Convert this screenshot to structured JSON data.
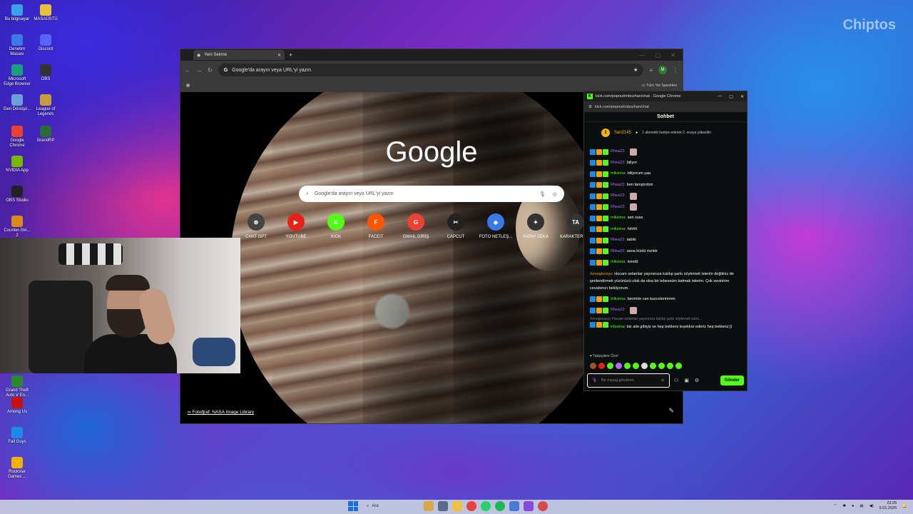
{
  "watermark": "Chiptos",
  "desktop_icons": [
    {
      "label": "Bu bilgisayar",
      "color": "#3aa0e8"
    },
    {
      "label": "MASAÜSTÜ",
      "color": "#e8c23a"
    },
    {
      "label": "Denetim Masası",
      "color": "#3a7ae8"
    },
    {
      "label": "Discord",
      "color": "#5865f2"
    },
    {
      "label": "Microsoft Edge Browser",
      "color": "#1aa07a"
    },
    {
      "label": "OBS",
      "color": "#333333"
    },
    {
      "label": "Geri Dönüşü...",
      "color": "#6aa0d8"
    },
    {
      "label": "League of Legends",
      "color": "#c89b3c"
    },
    {
      "label": "Google Chrome",
      "color": "#e94235"
    },
    {
      "label": "GrandRP",
      "color": "#2a6a3a"
    },
    {
      "label": "NVIDIA App",
      "color": "#76b900"
    },
    {
      "label": "OBS Studio",
      "color": "#222222"
    },
    {
      "label": "Counter-Stri... 2",
      "color": "#d88a1a"
    },
    {
      "label": "Grand Theft Auto V En...",
      "color": "#2a8a2a"
    },
    {
      "label": "Among Us",
      "color": "#c51111"
    },
    {
      "label": "Fall Guys",
      "color": "#1a8ae8"
    },
    {
      "label": "Rockstar Games ...",
      "color": "#f0b400"
    }
  ],
  "browser": {
    "tab_title": "Yeni Sekme",
    "url_placeholder": "Google'da arayın veya URL'yi yazın",
    "bookmarks_all": "Tüm Yer İşaretleri",
    "profile_initial": "M",
    "google_logo": "Google",
    "search_placeholder": "Google'da arayın veya URL'yi yazın",
    "shortcuts": [
      {
        "label": "CHAT GPT",
        "glyph": "⊛",
        "color": "#444444"
      },
      {
        "label": "YOUTUBE",
        "glyph": "▶",
        "color": "#e62117"
      },
      {
        "label": "KICK",
        "glyph": "K",
        "color": "#53fc18"
      },
      {
        "label": "FACEIT",
        "glyph": "F",
        "color": "#ff5500"
      },
      {
        "label": "GMAIL GİRİŞ",
        "glyph": "G",
        "color": "#ea4335"
      },
      {
        "label": "CAPCUT",
        "glyph": "✂",
        "color": "#222222"
      },
      {
        "label": "FOTO NETLEŞ...",
        "glyph": "◆",
        "color": "#3a7ae8"
      },
      {
        "label": "YAPAY ZEKA",
        "glyph": "✦",
        "color": "#333333"
      },
      {
        "label": "KARAKTER O...",
        "glyph": "TA",
        "color": "#333333"
      }
    ],
    "photo_credit": "Fotoğraf: NASA Image Library"
  },
  "chat": {
    "window_title": "kick.com/popout/mbozhan/chat - Google Chrome",
    "url": "kick.com/popout/mbozhan/chat",
    "header": "Sohbet",
    "pinned": {
      "rank": "1",
      "user": "Sari2145",
      "message": "1 abonelik hediye ederek 2. sıraya yükseltin"
    },
    "messages": [
      {
        "user": "Rhea22:",
        "text": "",
        "ucolor": "pink",
        "emote": true
      },
      {
        "user": "Rhea22:",
        "text": "biliyor",
        "ucolor": "pink",
        "emote": false
      },
      {
        "user": "mlksima:",
        "text": "biliyorum yaa",
        "ucolor": "green",
        "emote": false
      },
      {
        "user": "Rhea22:",
        "text": "ben tanıştırdım",
        "ucolor": "pink",
        "emote": false
      },
      {
        "user": "Rhea22:",
        "text": "",
        "ucolor": "pink",
        "emote": true
      },
      {
        "user": "Rhea22:",
        "text": "",
        "ucolor": "pink",
        "emote": true
      },
      {
        "user": "mlksima:",
        "text": "sen suss",
        "ucolor": "green",
        "emote": false
      },
      {
        "user": "mlksima:",
        "text": "hıhhh",
        "ucolor": "green",
        "emote": false
      },
      {
        "user": "Rhea22:",
        "text": "tabiki",
        "ucolor": "pink",
        "emote": false
      },
      {
        "user": "Rhea22:",
        "text": "sana küstü melek",
        "ucolor": "pink",
        "emote": false
      },
      {
        "user": "mlksima:",
        "text": "iveettt",
        "ucolor": "green",
        "emote": false
      }
    ],
    "long_message": {
      "user": "Xenogiossyy:",
      "text": "Hocam selamlar yayınınıza katılıp şarkı söylemek isterim değiliniz de şenlendirmek yüzünüzü ufak da olsa bir tebessüm katmak isterim. Çok sevinirim cevabınızı bekliyorum."
    },
    "messages_after": [
      {
        "user": "mlksima:",
        "text": "benmim can kuzcelerimmm",
        "ucolor": "green",
        "emote": false
      },
      {
        "user": "Rhea22:",
        "text": "",
        "ucolor": "pink",
        "emote": true
      }
    ],
    "reply_preview": "Xenogiossyy: Hocam selamlar yayınınıza katılıp şarkı söylemek isteri...",
    "last_message": {
      "user": "mlksima:",
      "text": "biz aile gibiyiz ve hep bekleriz teşekkür ederiz hep bekleriz:))"
    },
    "followers_label": "Takipçilere Özel",
    "input_placeholder": "Bir mesaj gönderin",
    "send_label": "Gönder"
  },
  "taskbar": {
    "search_label": "Ara",
    "time": "23:25",
    "date": "9.01.2026"
  }
}
